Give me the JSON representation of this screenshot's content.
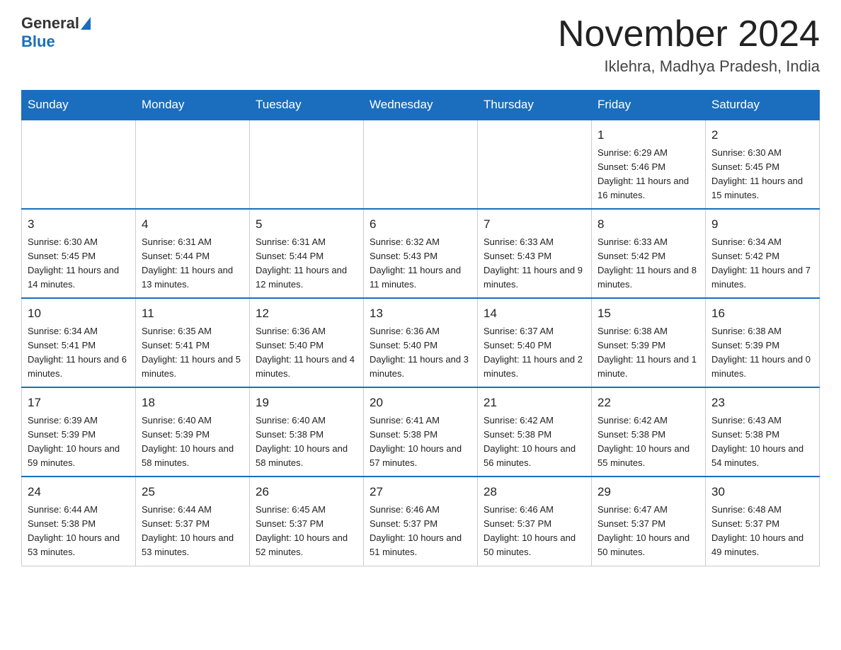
{
  "header": {
    "logo_general": "General",
    "logo_blue": "Blue",
    "title": "November 2024",
    "subtitle": "Iklehra, Madhya Pradesh, India"
  },
  "days_of_week": [
    "Sunday",
    "Monday",
    "Tuesday",
    "Wednesday",
    "Thursday",
    "Friday",
    "Saturday"
  ],
  "weeks": [
    {
      "days": [
        {
          "num": "",
          "info": ""
        },
        {
          "num": "",
          "info": ""
        },
        {
          "num": "",
          "info": ""
        },
        {
          "num": "",
          "info": ""
        },
        {
          "num": "",
          "info": ""
        },
        {
          "num": "1",
          "info": "Sunrise: 6:29 AM\nSunset: 5:46 PM\nDaylight: 11 hours and 16 minutes."
        },
        {
          "num": "2",
          "info": "Sunrise: 6:30 AM\nSunset: 5:45 PM\nDaylight: 11 hours and 15 minutes."
        }
      ]
    },
    {
      "days": [
        {
          "num": "3",
          "info": "Sunrise: 6:30 AM\nSunset: 5:45 PM\nDaylight: 11 hours and 14 minutes."
        },
        {
          "num": "4",
          "info": "Sunrise: 6:31 AM\nSunset: 5:44 PM\nDaylight: 11 hours and 13 minutes."
        },
        {
          "num": "5",
          "info": "Sunrise: 6:31 AM\nSunset: 5:44 PM\nDaylight: 11 hours and 12 minutes."
        },
        {
          "num": "6",
          "info": "Sunrise: 6:32 AM\nSunset: 5:43 PM\nDaylight: 11 hours and 11 minutes."
        },
        {
          "num": "7",
          "info": "Sunrise: 6:33 AM\nSunset: 5:43 PM\nDaylight: 11 hours and 9 minutes."
        },
        {
          "num": "8",
          "info": "Sunrise: 6:33 AM\nSunset: 5:42 PM\nDaylight: 11 hours and 8 minutes."
        },
        {
          "num": "9",
          "info": "Sunrise: 6:34 AM\nSunset: 5:42 PM\nDaylight: 11 hours and 7 minutes."
        }
      ]
    },
    {
      "days": [
        {
          "num": "10",
          "info": "Sunrise: 6:34 AM\nSunset: 5:41 PM\nDaylight: 11 hours and 6 minutes."
        },
        {
          "num": "11",
          "info": "Sunrise: 6:35 AM\nSunset: 5:41 PM\nDaylight: 11 hours and 5 minutes."
        },
        {
          "num": "12",
          "info": "Sunrise: 6:36 AM\nSunset: 5:40 PM\nDaylight: 11 hours and 4 minutes."
        },
        {
          "num": "13",
          "info": "Sunrise: 6:36 AM\nSunset: 5:40 PM\nDaylight: 11 hours and 3 minutes."
        },
        {
          "num": "14",
          "info": "Sunrise: 6:37 AM\nSunset: 5:40 PM\nDaylight: 11 hours and 2 minutes."
        },
        {
          "num": "15",
          "info": "Sunrise: 6:38 AM\nSunset: 5:39 PM\nDaylight: 11 hours and 1 minute."
        },
        {
          "num": "16",
          "info": "Sunrise: 6:38 AM\nSunset: 5:39 PM\nDaylight: 11 hours and 0 minutes."
        }
      ]
    },
    {
      "days": [
        {
          "num": "17",
          "info": "Sunrise: 6:39 AM\nSunset: 5:39 PM\nDaylight: 10 hours and 59 minutes."
        },
        {
          "num": "18",
          "info": "Sunrise: 6:40 AM\nSunset: 5:39 PM\nDaylight: 10 hours and 58 minutes."
        },
        {
          "num": "19",
          "info": "Sunrise: 6:40 AM\nSunset: 5:38 PM\nDaylight: 10 hours and 58 minutes."
        },
        {
          "num": "20",
          "info": "Sunrise: 6:41 AM\nSunset: 5:38 PM\nDaylight: 10 hours and 57 minutes."
        },
        {
          "num": "21",
          "info": "Sunrise: 6:42 AM\nSunset: 5:38 PM\nDaylight: 10 hours and 56 minutes."
        },
        {
          "num": "22",
          "info": "Sunrise: 6:42 AM\nSunset: 5:38 PM\nDaylight: 10 hours and 55 minutes."
        },
        {
          "num": "23",
          "info": "Sunrise: 6:43 AM\nSunset: 5:38 PM\nDaylight: 10 hours and 54 minutes."
        }
      ]
    },
    {
      "days": [
        {
          "num": "24",
          "info": "Sunrise: 6:44 AM\nSunset: 5:38 PM\nDaylight: 10 hours and 53 minutes."
        },
        {
          "num": "25",
          "info": "Sunrise: 6:44 AM\nSunset: 5:37 PM\nDaylight: 10 hours and 53 minutes."
        },
        {
          "num": "26",
          "info": "Sunrise: 6:45 AM\nSunset: 5:37 PM\nDaylight: 10 hours and 52 minutes."
        },
        {
          "num": "27",
          "info": "Sunrise: 6:46 AM\nSunset: 5:37 PM\nDaylight: 10 hours and 51 minutes."
        },
        {
          "num": "28",
          "info": "Sunrise: 6:46 AM\nSunset: 5:37 PM\nDaylight: 10 hours and 50 minutes."
        },
        {
          "num": "29",
          "info": "Sunrise: 6:47 AM\nSunset: 5:37 PM\nDaylight: 10 hours and 50 minutes."
        },
        {
          "num": "30",
          "info": "Sunrise: 6:48 AM\nSunset: 5:37 PM\nDaylight: 10 hours and 49 minutes."
        }
      ]
    }
  ]
}
